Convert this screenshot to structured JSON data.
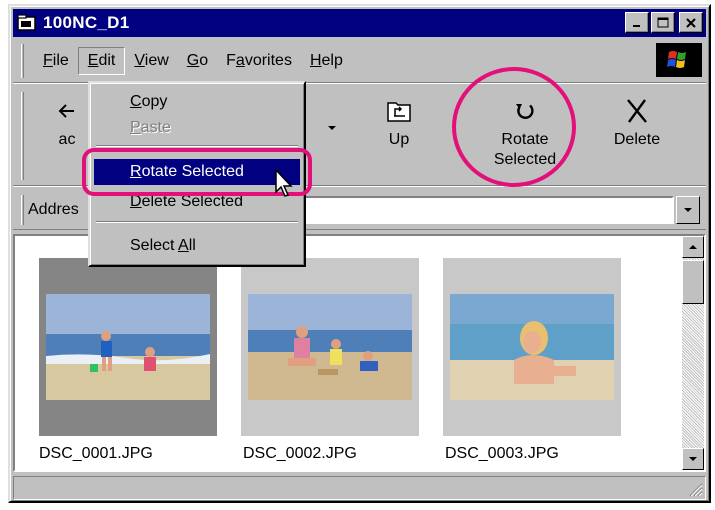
{
  "window": {
    "title": "100NC_D1"
  },
  "menubar": {
    "items": [
      {
        "label": "File",
        "ul": "F",
        "rest": "ile"
      },
      {
        "label": "Edit",
        "ul": "E",
        "rest": "dit"
      },
      {
        "label": "View",
        "ul": "V",
        "rest": "iew"
      },
      {
        "label": "Go",
        "ul": "G",
        "rest": "o"
      },
      {
        "pre": "F",
        "ul": "a",
        "rest": "vorites",
        "label": "Favorites"
      },
      {
        "label": "Help",
        "ul": "H",
        "rest": "elp"
      }
    ]
  },
  "toolbar": {
    "back_partial": "ac",
    "up_label": "Up",
    "rotate_label_1": "Rotate",
    "rotate_label_2": "Selected",
    "delete_label": "Delete"
  },
  "address": {
    "label": "Addres"
  },
  "edit_menu": {
    "copy": {
      "ul": "C",
      "rest": "opy"
    },
    "paste": {
      "ul": "P",
      "rest": "aste"
    },
    "rotate_selected": {
      "ul": "R",
      "rest": "otate Selected"
    },
    "delete_selected": {
      "ul": "D",
      "rest": "elete Selected"
    },
    "select_all": {
      "pre": "Select ",
      "ul": "A",
      "rest": "ll"
    }
  },
  "files": [
    {
      "name": "DSC_0001.JPG",
      "selected": true
    },
    {
      "name": "DSC_0002.JPG",
      "selected": false
    },
    {
      "name": "DSC_0003.JPG",
      "selected": false
    }
  ],
  "colors": {
    "titlebar": "#000080",
    "highlight": "#000080",
    "annotation_ring": "#e3107a",
    "face": "#c0c0c0"
  }
}
